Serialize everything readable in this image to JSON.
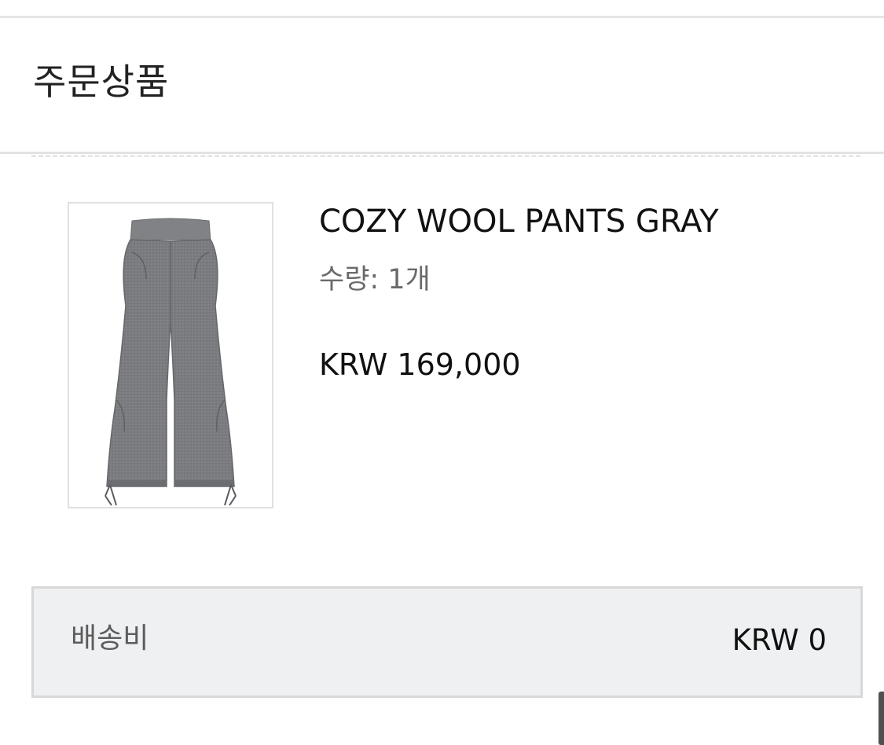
{
  "section": {
    "title": "주문상품"
  },
  "order_item": {
    "image_alt": "COZY WOOL PANTS GRAY",
    "name": "COZY WOOL PANTS GRAY",
    "quantity_text": "수량: 1개",
    "price_text": "KRW 169,000",
    "image_colors": {
      "fabric": "#7b7c80",
      "fabric_shade": "#66676b",
      "cord": "#5a5b60"
    }
  },
  "shipping": {
    "label": "배송비",
    "value": "KRW 0"
  }
}
